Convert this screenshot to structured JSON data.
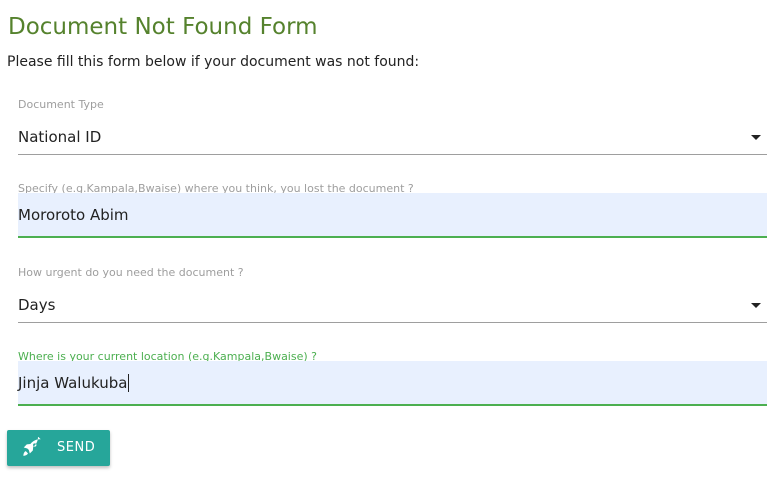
{
  "page": {
    "title": "Document Not Found Form",
    "subtitle": "Please fill this form below if your document was not found:"
  },
  "form": {
    "document_type": {
      "label": "Document Type",
      "value": "National ID"
    },
    "lost_location": {
      "label": "Specify (e.g.Kampala,Bwaise) where you think, you lost the document ?",
      "value": "Mororoto Abim"
    },
    "urgency": {
      "label": "How urgent do you need the document ?",
      "value": "Days"
    },
    "current_location": {
      "label": "Where is your current location (e.g.Kampala,Bwaise) ?",
      "value": "Jinja Walukuba"
    },
    "send_button": {
      "label": "SEND",
      "icon": "rocket-icon"
    }
  },
  "colors": {
    "title_green": "#55822d",
    "active_green": "#4caf50",
    "button_teal": "#26a69a",
    "autofill_blue": "#e8f0fe"
  }
}
